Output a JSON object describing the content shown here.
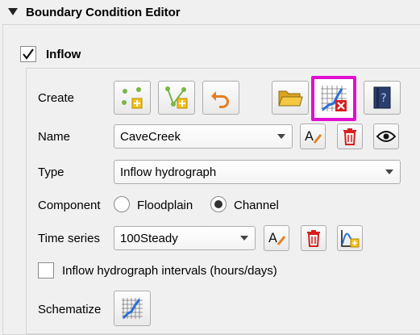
{
  "panel": {
    "title": "Boundary Condition Editor"
  },
  "inflow": {
    "label": "Inflow",
    "checked": true
  },
  "create": {
    "label": "Create"
  },
  "name": {
    "label": "Name",
    "value": "CaveCreek"
  },
  "type": {
    "label": "Type",
    "value": "Inflow hydrograph"
  },
  "component": {
    "label": "Component",
    "floodplain_label": "Floodplain",
    "channel_label": "Channel",
    "selected": "Channel"
  },
  "time_series": {
    "label": "Time series",
    "value": "100Steady"
  },
  "intervals": {
    "label": "Inflow hydrograph intervals (hours/days)",
    "checked": false
  },
  "schematize": {
    "label": "Schematize"
  },
  "colors": {
    "highlight": "#e010d0",
    "delete_red": "#d42020",
    "line_blue": "#2a6fd6"
  }
}
